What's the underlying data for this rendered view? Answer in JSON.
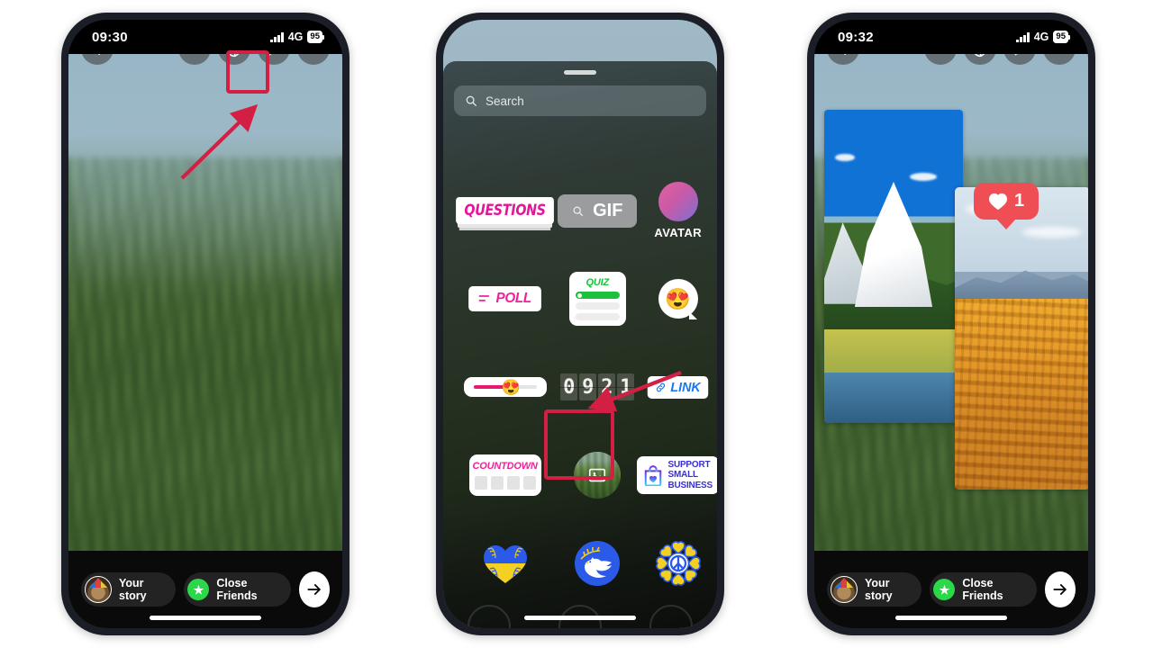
{
  "accent": {
    "highlight": "#d41f45",
    "instagram_pink": "#e5149b",
    "like_red": "#ef4f54"
  },
  "phones": [
    {
      "id": "phone-1",
      "status": {
        "time": "09:30",
        "network": "4G",
        "battery": "95"
      },
      "toolbar": {
        "back": "‹",
        "text_tool": "Aa",
        "sticker_tool": "sticker",
        "effects_tool": "sparkles",
        "more_tool": "…"
      },
      "share": {
        "your_story": "Your story",
        "close_friends": "Close Friends",
        "send": "→"
      }
    },
    {
      "id": "phone-2",
      "tray": {
        "search_placeholder": "Search",
        "stickers": [
          {
            "name": "questions",
            "label": "QUESTIONS"
          },
          {
            "name": "gif",
            "label": "GIF"
          },
          {
            "name": "avatar",
            "label": "AVATAR"
          },
          {
            "name": "poll",
            "label": "POLL"
          },
          {
            "name": "quiz",
            "label": "QUIZ"
          },
          {
            "name": "emoji-reaction",
            "label": "😍"
          },
          {
            "name": "emoji-slider",
            "label": "😍"
          },
          {
            "name": "clock",
            "label": "0921"
          },
          {
            "name": "link",
            "label": "LINK"
          },
          {
            "name": "countdown",
            "label": "COUNTDOWN"
          },
          {
            "name": "photo",
            "label": ""
          },
          {
            "name": "support-small-business",
            "label": "SUPPORT SMALL BUSINESS"
          },
          {
            "name": "ukraine-heart",
            "label": ""
          },
          {
            "name": "peace-dove",
            "label": ""
          },
          {
            "name": "peace-sunflower",
            "label": ""
          }
        ],
        "clock_digits": [
          "0",
          "9",
          "2",
          "1"
        ],
        "business_lines": [
          "SUPPORT",
          "SMALL",
          "BUSINESS"
        ]
      }
    },
    {
      "id": "phone-3",
      "status": {
        "time": "09:32",
        "network": "4G",
        "battery": "95"
      },
      "toolbar": {
        "back": "‹",
        "text_tool": "Aa",
        "sticker_tool": "sticker",
        "effects_tool": "sparkles",
        "more_tool": "…"
      },
      "like_sticker": {
        "count": "1"
      },
      "share": {
        "your_story": "Your story",
        "close_friends": "Close Friends",
        "send": "→"
      }
    }
  ]
}
